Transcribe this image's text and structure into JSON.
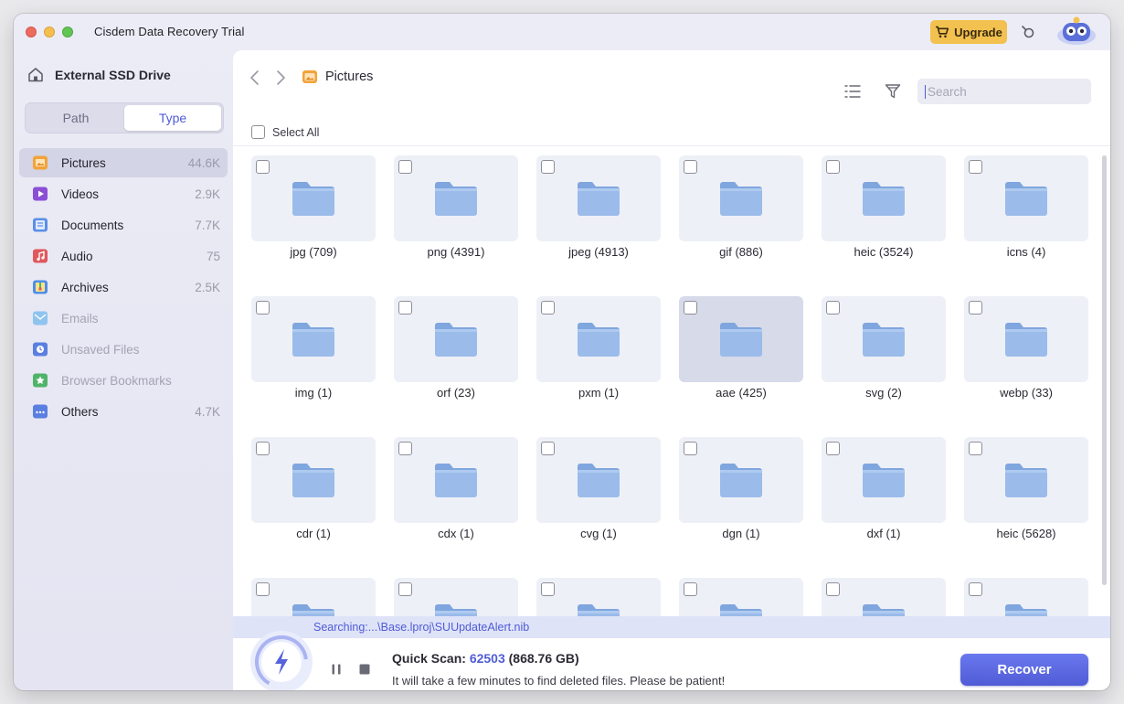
{
  "app": {
    "title": "Cisdem Data Recovery  Trial",
    "upgrade_label": "Upgrade"
  },
  "sidebar": {
    "drive": "External SSD Drive",
    "tabs": [
      {
        "label": "Path",
        "active": false
      },
      {
        "label": "Type",
        "active": true
      }
    ],
    "categories": [
      {
        "label": "Pictures",
        "count": "44.6K",
        "icon": "pictures-icon",
        "color": "#f2a33a",
        "active": true,
        "disabled": false
      },
      {
        "label": "Videos",
        "count": "2.9K",
        "icon": "videos-icon",
        "color": "#8b4fd6",
        "active": false,
        "disabled": false
      },
      {
        "label": "Documents",
        "count": "7.7K",
        "icon": "documents-icon",
        "color": "#5b8fe8",
        "active": false,
        "disabled": false
      },
      {
        "label": "Audio",
        "count": "75",
        "icon": "audio-icon",
        "color": "#e0575c",
        "active": false,
        "disabled": false
      },
      {
        "label": "Archives",
        "count": "2.5K",
        "icon": "archives-icon",
        "color": "#4f8ee8",
        "active": false,
        "disabled": false
      },
      {
        "label": "Emails",
        "count": "",
        "icon": "emails-icon",
        "color": "#8fc4ee",
        "active": false,
        "disabled": true
      },
      {
        "label": "Unsaved Files",
        "count": "",
        "icon": "unsaved-files-icon",
        "color": "#5b7fe0",
        "active": false,
        "disabled": true
      },
      {
        "label": "Browser Bookmarks",
        "count": "",
        "icon": "bookmarks-icon",
        "color": "#4fb36a",
        "active": false,
        "disabled": true
      },
      {
        "label": "Others",
        "count": "4.7K",
        "icon": "others-icon",
        "color": "#5b7fe0",
        "active": false,
        "disabled": false
      }
    ]
  },
  "toolbar": {
    "breadcrumb": "Pictures",
    "search_placeholder": "Search",
    "select_all": "Select All"
  },
  "grid": {
    "items": [
      {
        "label": "jpg (709)",
        "highlighted": false
      },
      {
        "label": "png (4391)",
        "highlighted": false
      },
      {
        "label": "jpeg (4913)",
        "highlighted": false
      },
      {
        "label": "gif (886)",
        "highlighted": false
      },
      {
        "label": "heic (3524)",
        "highlighted": false
      },
      {
        "label": "icns (4)",
        "highlighted": false
      },
      {
        "label": "img (1)",
        "highlighted": false
      },
      {
        "label": "orf (23)",
        "highlighted": false
      },
      {
        "label": "pxm (1)",
        "highlighted": false
      },
      {
        "label": "aae (425)",
        "highlighted": true
      },
      {
        "label": "svg (2)",
        "highlighted": false
      },
      {
        "label": "webp (33)",
        "highlighted": false
      },
      {
        "label": "cdr (1)",
        "highlighted": false
      },
      {
        "label": "cdx (1)",
        "highlighted": false
      },
      {
        "label": "cvg (1)",
        "highlighted": false
      },
      {
        "label": "dgn (1)",
        "highlighted": false
      },
      {
        "label": "dxf (1)",
        "highlighted": false
      },
      {
        "label": "heic (5628)",
        "highlighted": false
      },
      {
        "label": "",
        "highlighted": false
      },
      {
        "label": "",
        "highlighted": false
      },
      {
        "label": "",
        "highlighted": false
      },
      {
        "label": "",
        "highlighted": false
      },
      {
        "label": "",
        "highlighted": false
      },
      {
        "label": "",
        "highlighted": false
      }
    ]
  },
  "scan": {
    "searching_path": "Searching:...\\Base.lproj\\SUUpdateAlert.nib",
    "title_prefix": "Quick Scan: ",
    "file_count": "62503",
    "size": " (868.76 GB)",
    "note": "It will take a few minutes to find deleted files. Please be patient!",
    "recover_label": "Recover"
  },
  "colors": {
    "accent": "#4f5cd6",
    "upgrade": "#f2c14f",
    "folder": "#8fb3e6"
  }
}
